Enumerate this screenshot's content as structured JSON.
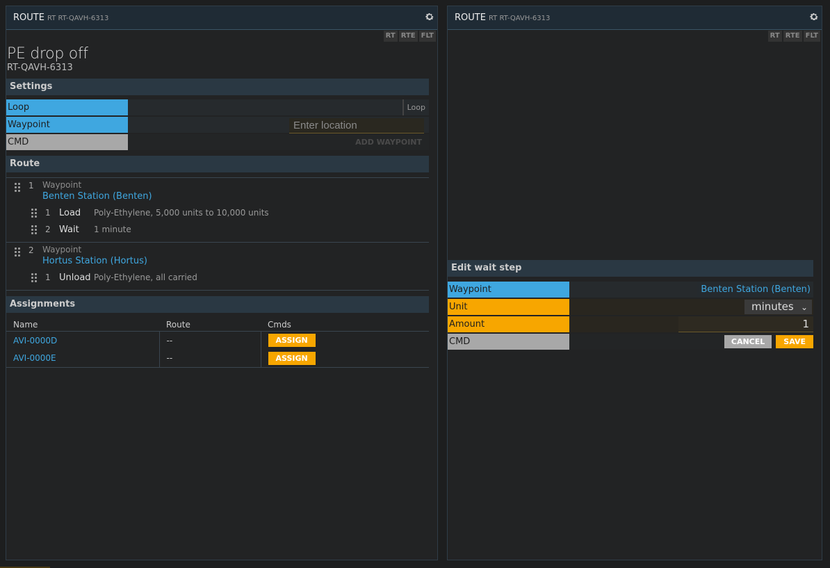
{
  "left": {
    "header": {
      "title": "ROUTE",
      "subtitle": "RT RT-QAVH-6313",
      "icon": "gear-icon"
    },
    "tabs": [
      "RT",
      "RTE",
      "FLT"
    ],
    "route_name": "PE drop off",
    "route_id": "RT-QAVH-6313",
    "settings": {
      "header": "Settings",
      "loop_label": "Loop",
      "loop_toggle": "Loop",
      "waypoint_label": "Waypoint",
      "location_placeholder": "Enter location",
      "cmd_label": "CMD",
      "add_waypoint": "ADD WAYPOINT"
    },
    "route": {
      "header": "Route",
      "waypoints": [
        {
          "num": "1",
          "kind": "Waypoint",
          "name": "Benten Station (Benten)",
          "steps": [
            {
              "num": "1",
              "action": "Load",
              "desc": "Poly-Ethylene, 5,000 units to 10,000 units"
            },
            {
              "num": "2",
              "action": "Wait",
              "desc": "1 minute"
            }
          ]
        },
        {
          "num": "2",
          "kind": "Waypoint",
          "name": "Hortus Station (Hortus)",
          "steps": [
            {
              "num": "1",
              "action": "Unload",
              "desc": "Poly-Ethylene, all carried"
            }
          ]
        }
      ]
    },
    "assignments": {
      "header": "Assignments",
      "columns": [
        "Name",
        "Route",
        "Cmds"
      ],
      "rows": [
        {
          "name": "AVI-0000D",
          "route": "--",
          "cmd": "ASSIGN"
        },
        {
          "name": "AVI-0000E",
          "route": "--",
          "cmd": "ASSIGN"
        }
      ]
    }
  },
  "right": {
    "header": {
      "title": "ROUTE",
      "subtitle": "RT RT-QAVH-6313",
      "icon": "gear-icon"
    },
    "tabs": [
      "RT",
      "RTE",
      "FLT"
    ],
    "edit": {
      "header": "Edit wait step",
      "waypoint_label": "Waypoint",
      "waypoint_value": "Benten Station (Benten)",
      "unit_label": "Unit",
      "unit_value": "minutes",
      "amount_label": "Amount",
      "amount_value": "1",
      "cmd_label": "CMD",
      "cancel": "CANCEL",
      "save": "SAVE"
    }
  },
  "colors": {
    "blue": "#3fa7e0",
    "orange": "#f7a600",
    "gray": "#a8a8a8"
  }
}
